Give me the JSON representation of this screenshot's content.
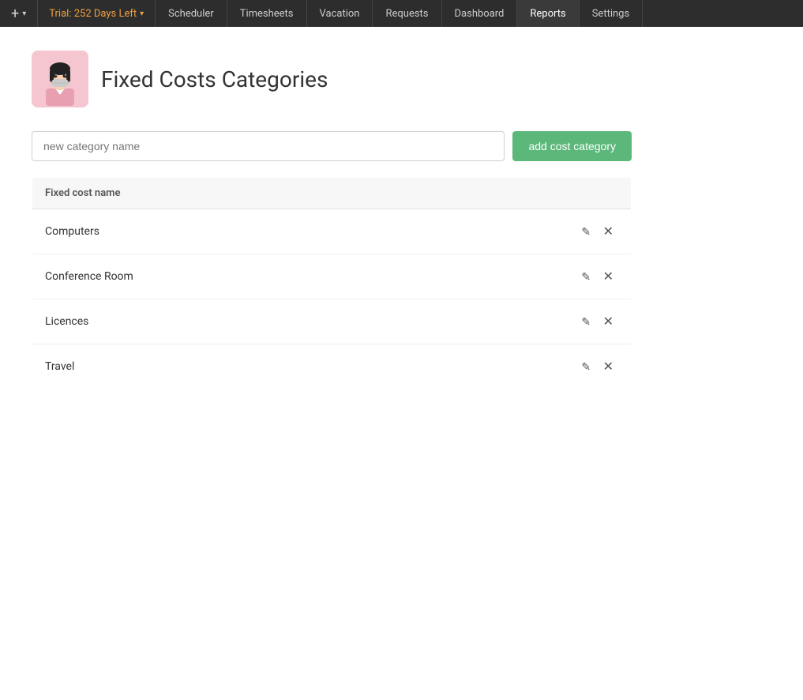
{
  "nav": {
    "plus_label": "+",
    "chevron": "▾",
    "trial_label": "Trial: 252 Days Left",
    "items": [
      {
        "id": "scheduler",
        "label": "Scheduler"
      },
      {
        "id": "timesheets",
        "label": "Timesheets"
      },
      {
        "id": "vacation",
        "label": "Vacation"
      },
      {
        "id": "requests",
        "label": "Requests"
      },
      {
        "id": "dashboard",
        "label": "Dashboard"
      },
      {
        "id": "reports",
        "label": "Reports"
      },
      {
        "id": "settings",
        "label": "Settings"
      }
    ]
  },
  "page": {
    "title": "Fixed Costs Categories"
  },
  "form": {
    "input_placeholder": "new category name",
    "add_button_label": "add cost category"
  },
  "table": {
    "column_header": "Fixed cost name",
    "rows": [
      {
        "id": "computers",
        "name": "Computers"
      },
      {
        "id": "conference-room",
        "name": "Conference Room"
      },
      {
        "id": "licences",
        "name": "Licences"
      },
      {
        "id": "travel",
        "name": "Travel"
      }
    ]
  }
}
